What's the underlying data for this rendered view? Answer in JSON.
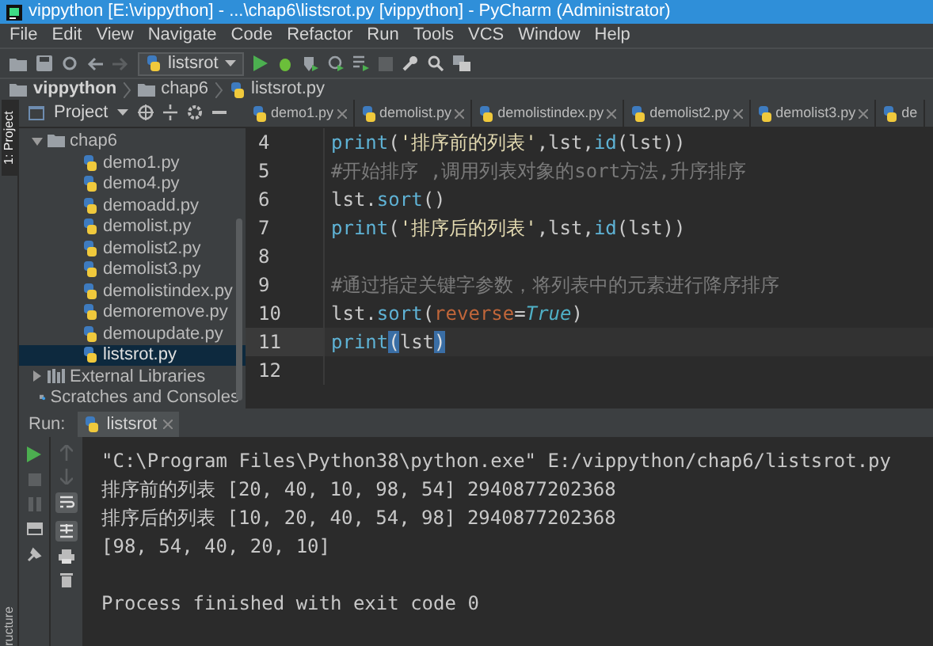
{
  "window": {
    "title": "vippython [E:\\vippython] - ...\\chap6\\listsrot.py [vippython] - PyCharm (Administrator)"
  },
  "menu": [
    "File",
    "Edit",
    "View",
    "Navigate",
    "Code",
    "Refactor",
    "Run",
    "Tools",
    "VCS",
    "Window",
    "Help"
  ],
  "toolbar": {
    "run_config": "listsrot"
  },
  "breadcrumb": [
    "vippython",
    "chap6",
    "listsrot.py"
  ],
  "side_strip": {
    "top": "1: Project",
    "bottom": "ructure"
  },
  "project_panel": {
    "title": "Project",
    "tree": [
      {
        "label": "chap6",
        "kind": "folder",
        "expanded": true,
        "selected": false,
        "children": [
          {
            "label": "demo1.py",
            "kind": "py",
            "selected": false
          },
          {
            "label": "demo4.py",
            "kind": "py",
            "selected": false
          },
          {
            "label": "demoadd.py",
            "kind": "py",
            "selected": false
          },
          {
            "label": "demolist.py",
            "kind": "py",
            "selected": false
          },
          {
            "label": "demolist2.py",
            "kind": "py",
            "selected": false
          },
          {
            "label": "demolist3.py",
            "kind": "py",
            "selected": false
          },
          {
            "label": "demolistindex.py",
            "kind": "py",
            "selected": false
          },
          {
            "label": "demoremove.py",
            "kind": "py",
            "selected": false
          },
          {
            "label": "demoupdate.py",
            "kind": "py",
            "selected": false
          },
          {
            "label": "listsrot.py",
            "kind": "py",
            "selected": true
          }
        ]
      },
      {
        "label": "External Libraries",
        "kind": "library",
        "expanded": false,
        "selected": false
      },
      {
        "label": "Scratches and Consoles",
        "kind": "scratches",
        "selected": false
      }
    ]
  },
  "editor": {
    "tabs": [
      {
        "label": "demo1.py",
        "closable": true
      },
      {
        "label": "demolist.py",
        "closable": true
      },
      {
        "label": "demolistindex.py",
        "closable": true
      },
      {
        "label": "demolist2.py",
        "closable": true
      },
      {
        "label": "demolist3.py",
        "closable": true
      },
      {
        "label": "de",
        "closable": false
      }
    ],
    "lines": [
      {
        "number": "4",
        "current": false,
        "tokens": [
          {
            "kind": "builtin",
            "text": "print"
          },
          {
            "kind": "plain",
            "text": "("
          },
          {
            "kind": "string",
            "text": "'排序前的列表'"
          },
          {
            "kind": "plain",
            "text": ",lst,"
          },
          {
            "kind": "builtin",
            "text": "id"
          },
          {
            "kind": "plain",
            "text": "(lst))"
          }
        ]
      },
      {
        "number": "5",
        "current": false,
        "tokens": [
          {
            "kind": "comment",
            "text": "#开始排序 ,调用列表对象的sort方法,升序排序"
          }
        ]
      },
      {
        "number": "6",
        "current": false,
        "tokens": [
          {
            "kind": "plain",
            "text": "lst."
          },
          {
            "kind": "builtin",
            "text": "sort"
          },
          {
            "kind": "plain",
            "text": "()"
          }
        ]
      },
      {
        "number": "7",
        "current": false,
        "tokens": [
          {
            "kind": "builtin",
            "text": "print"
          },
          {
            "kind": "plain",
            "text": "("
          },
          {
            "kind": "string",
            "text": "'排序后的列表'"
          },
          {
            "kind": "plain",
            "text": ",lst,"
          },
          {
            "kind": "builtin",
            "text": "id"
          },
          {
            "kind": "plain",
            "text": "(lst))"
          }
        ]
      },
      {
        "number": "8",
        "current": false
      },
      {
        "number": "9",
        "current": false,
        "tokens": [
          {
            "kind": "comment",
            "text": "#通过指定关键字参数，将列表中的元素进行降序排序"
          }
        ]
      },
      {
        "number": "10",
        "current": false,
        "tokens": [
          {
            "kind": "plain",
            "text": "lst."
          },
          {
            "kind": "builtin",
            "text": "sort"
          },
          {
            "kind": "plain",
            "text": "("
          },
          {
            "kind": "param",
            "text": "reverse"
          },
          {
            "kind": "plain",
            "text": "="
          },
          {
            "kind": "constant",
            "text": "True"
          },
          {
            "kind": "plain",
            "text": ")"
          }
        ]
      },
      {
        "number": "11",
        "current": true,
        "tokens": [
          {
            "kind": "builtin",
            "text": "print"
          },
          {
            "kind": "match",
            "text": "("
          },
          {
            "kind": "plain",
            "text": "lst"
          },
          {
            "kind": "match",
            "text": ")"
          }
        ]
      },
      {
        "number": "12",
        "current": false
      }
    ]
  },
  "run_panel": {
    "label": "Run:",
    "tab": "listsrot",
    "output": [
      "\"C:\\Program Files\\Python38\\python.exe\" E:/vippython/chap6/listsrot.py",
      "排序前的列表 [20, 40, 10, 98, 54] 2940877202368",
      "排序后的列表 [10, 20, 40, 54, 98] 2940877202368",
      "[98, 54, 40, 20, 10]"
    ],
    "exit_message": "Process finished with exit code 0"
  }
}
